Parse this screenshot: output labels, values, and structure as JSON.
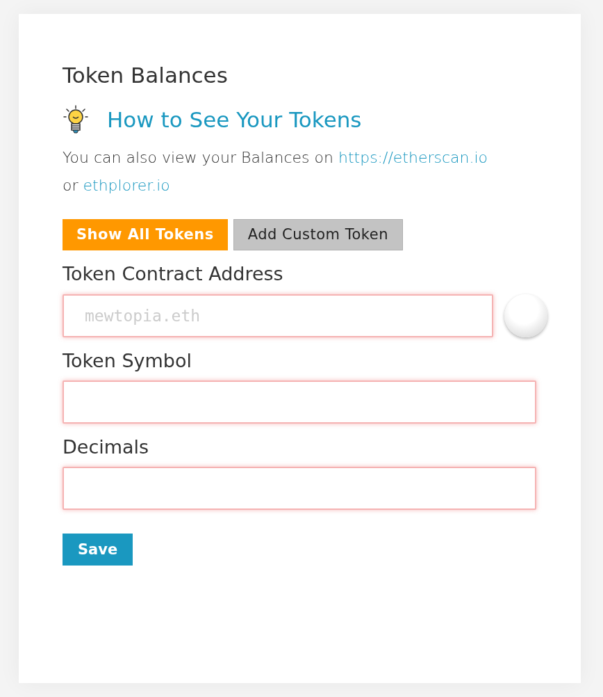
{
  "title": "Token Balances",
  "help": {
    "heading": "How to See Your Tokens"
  },
  "note": {
    "text_before": "You can also view your Balances on ",
    "link_1": "https://etherscan.io",
    "text_between": " or ",
    "link_2": "ethplorer.io"
  },
  "buttons": [
    {
      "label": "Show All Tokens",
      "kind": "primary"
    },
    {
      "label": "Add Custom Token",
      "kind": "secondary"
    }
  ],
  "fields": [
    {
      "label": "Token Contract Address",
      "placeholder": "mewtopia.eth",
      "invalid": true,
      "identicon": true
    },
    {
      "label": "Token Symbol",
      "invalid": true,
      "identicon": false
    },
    {
      "label": "Decimals",
      "invalid": true,
      "identicon": false
    }
  ],
  "save": {
    "label": "Save"
  }
}
